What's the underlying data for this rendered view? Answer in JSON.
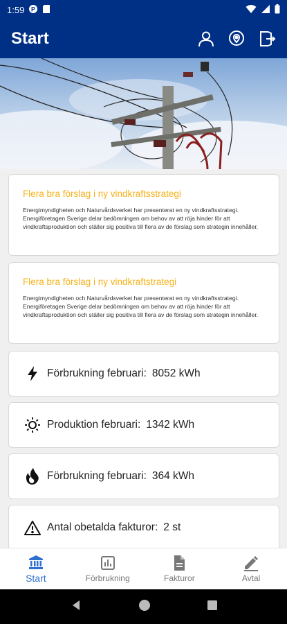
{
  "status_bar": {
    "time": "1:59"
  },
  "app_bar": {
    "title": "Start",
    "actions": [
      {
        "icon": "person-icon"
      },
      {
        "icon": "location-icon"
      },
      {
        "icon": "logout-icon"
      }
    ]
  },
  "news": [
    {
      "title": "Flera bra förslag i ny vindkraftsstrategi",
      "body": "Energimyndigheten och Naturvårdsverket har presenterat en ny vindkraftsstrategi. Energiföretagen Sverige delar bedömningen om behov av att röja hinder för att vindkraftsproduktion och ställer sig positiva till flera av de förslag som strategin innehåller."
    },
    {
      "title": "Flera bra förslag i ny vindkraftstrategi",
      "body": "Energimyndigheten och Naturvårdsverket har presenterat en ny vindkraftsstrategi. Energiföretagen Sverige delar bedömningen om behov av att röja hinder för att vindkraftsproduktion och ställer sig positiva till flera av de förslag som strategin innehåller."
    }
  ],
  "stats": [
    {
      "icon": "lightning-icon",
      "label": "Förbrukning februari:",
      "value": "8052 kWh"
    },
    {
      "icon": "sun-icon",
      "label": "Produktion februari:",
      "value": "1342 kWh"
    },
    {
      "icon": "flame-icon",
      "label": "Förbrukning februari:",
      "value": "364 kWh"
    },
    {
      "icon": "warning-icon",
      "label": "Antal obetalda fakturor:",
      "value": "2 st"
    }
  ],
  "bottom_nav": [
    {
      "label": "Start",
      "icon": "bank-icon",
      "active": true
    },
    {
      "label": "Förbrukning",
      "icon": "chart-icon",
      "active": false
    },
    {
      "label": "Fakturor",
      "icon": "document-icon",
      "active": false
    },
    {
      "label": "Avtal",
      "icon": "pen-icon",
      "active": false
    }
  ],
  "colors": {
    "primary": "#002f86",
    "accent": "#f5b21b",
    "nav_active": "#2f6fd0"
  }
}
